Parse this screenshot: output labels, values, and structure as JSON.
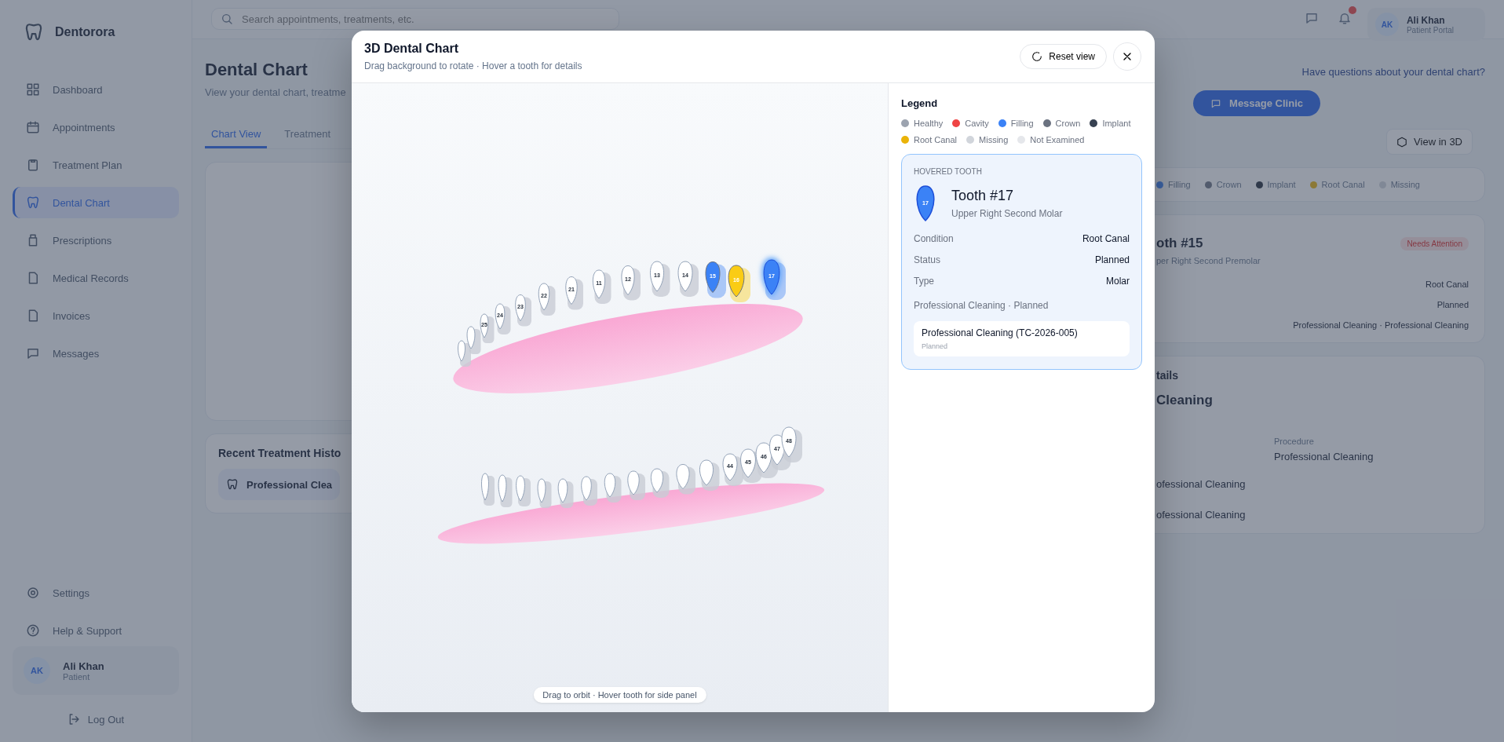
{
  "app": {
    "brand": "Dentorora",
    "search_placeholder": "Search appointments, treatments, etc.",
    "nav": [
      {
        "label": "Dashboard",
        "selected": false
      },
      {
        "label": "Appointments",
        "selected": false
      },
      {
        "label": "Treatment Plan",
        "selected": false
      },
      {
        "label": "Dental Chart",
        "selected": true
      },
      {
        "label": "Prescriptions",
        "selected": false
      },
      {
        "label": "Medical Records",
        "selected": false
      },
      {
        "label": "Invoices",
        "selected": false
      },
      {
        "label": "Messages",
        "selected": false
      }
    ],
    "footer_nav": [
      "Settings",
      "Help & Support"
    ],
    "user": {
      "initials": "AK",
      "name": "Ali Khan",
      "role": "Patient"
    },
    "logout": "Log Out",
    "header_user": {
      "initials": "AK",
      "name": "Ali Khan",
      "role": "Patient Portal"
    },
    "page_title": "Dental Chart",
    "page_subtitle": "View your dental chart, treatme",
    "tabs": [
      {
        "label": "Chart View",
        "selected": true
      },
      {
        "label": "Treatment",
        "selected": false
      }
    ],
    "recent_title": "Recent Treatment Histo",
    "recent_item": "Professional Clea",
    "help_question": "Have questions about your dental chart?",
    "message_button": "Message Clinic",
    "view3d_button": "View in 3D",
    "legend": [
      {
        "label": "Filling",
        "kind": "filling"
      },
      {
        "label": "Crown",
        "kind": "crown"
      },
      {
        "label": "Implant",
        "kind": "implant"
      },
      {
        "label": "Root Canal",
        "kind": "rootcanal"
      },
      {
        "label": "Missing",
        "kind": "missing"
      }
    ],
    "tooth_card": {
      "title": "oth #15",
      "badge": "Needs Attention",
      "subtitle": "per Right Second Premolar",
      "condition": "Root Canal",
      "status": "Planned",
      "treatments": "Professional Cleaning · Professional Cleaning"
    },
    "details": {
      "title": "tails",
      "name": "Cleaning",
      "field_label": "Procedure",
      "field_value": "Professional Cleaning"
    },
    "history": [
      "ofessional Cleaning",
      "ofessional Cleaning"
    ]
  },
  "modal": {
    "title": "3D Dental Chart",
    "subtitle": "Drag background to rotate · Hover a tooth for details",
    "reset_button": "Reset view",
    "hint": "Drag to orbit · Hover tooth for side panel",
    "upper_teeth": [
      {
        "color": "#ffffff",
        "hovered": false
      },
      {
        "color": "#ffffff",
        "hovered": false
      },
      {
        "label": "25",
        "color": "#ffffff",
        "hovered": false
      },
      {
        "label": "24",
        "color": "#ffffff",
        "hovered": false
      },
      {
        "label": "23",
        "color": "#ffffff",
        "hovered": false
      },
      {
        "label": "22",
        "color": "#ffffff",
        "hovered": false
      },
      {
        "label": "21",
        "color": "#ffffff",
        "hovered": false
      },
      {
        "label": "11",
        "color": "#ffffff",
        "hovered": false
      },
      {
        "label": "12",
        "color": "#ffffff",
        "hovered": false
      },
      {
        "label": "13",
        "color": "#ffffff",
        "hovered": false
      },
      {
        "label": "14",
        "color": "#ffffff",
        "hovered": false
      },
      {
        "label": "15",
        "color": "#3b82f6",
        "hovered": false
      },
      {
        "label": "16",
        "color": "#facc15",
        "hovered": false
      },
      {
        "label": "17",
        "color": "#3b82f6",
        "hovered": true
      }
    ],
    "lower_teeth": [
      {
        "color": "#ffffff",
        "hovered": false
      },
      {
        "color": "#ffffff",
        "hovered": false
      },
      {
        "color": "#ffffff",
        "hovered": false
      },
      {
        "color": "#ffffff",
        "hovered": false
      },
      {
        "color": "#ffffff",
        "hovered": false
      },
      {
        "color": "#ffffff",
        "hovered": false
      },
      {
        "color": "#ffffff",
        "hovered": false
      },
      {
        "color": "#ffffff",
        "hovered": false
      },
      {
        "color": "#ffffff",
        "hovered": false
      },
      {
        "color": "#ffffff",
        "hovered": false
      },
      {
        "color": "#ffffff",
        "hovered": false
      },
      {
        "label": "44",
        "color": "#ffffff",
        "hovered": false
      },
      {
        "label": "45",
        "color": "#ffffff",
        "hovered": false
      },
      {
        "label": "46",
        "color": "#ffffff",
        "hovered": false
      },
      {
        "label": "47",
        "color": "#ffffff",
        "hovered": false
      },
      {
        "label": "48",
        "color": "#ffffff",
        "hovered": false
      }
    ],
    "legend_title": "Legend",
    "legend": [
      {
        "label": "Healthy",
        "color": "#9ca3af"
      },
      {
        "label": "Cavity",
        "color": "#ef4444"
      },
      {
        "label": "Filling",
        "color": "#3b82f6"
      },
      {
        "label": "Crown",
        "color": "#6b7280"
      },
      {
        "label": "Implant",
        "color": "#374151"
      },
      {
        "label": "Root Canal",
        "color": "#eab308"
      },
      {
        "label": "Missing",
        "color": "#d1d5db"
      },
      {
        "label": "Not Examined",
        "color": "#e5e7eb"
      }
    ],
    "hovered": {
      "heading": "HOVERED TOOTH",
      "number": "17",
      "title": "Tooth #17",
      "subtitle": "Upper Right Second Molar",
      "details": [
        {
          "label": "Condition",
          "value": "Root Canal"
        },
        {
          "label": "Status",
          "value": "Planned"
        },
        {
          "label": "Type",
          "value": "Molar"
        }
      ],
      "summary": "Professional Cleaning · Planned",
      "treatments": [
        {
          "name": "Professional Cleaning (TC-2026-005)",
          "status": "Planned"
        }
      ]
    }
  }
}
